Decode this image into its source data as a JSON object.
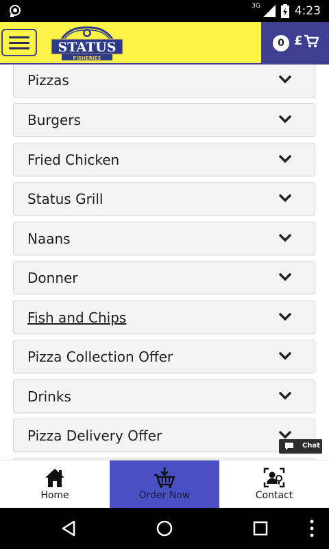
{
  "status_bar": {
    "time": "4:23",
    "network": "3G"
  },
  "header": {
    "logo_text": "STATUS",
    "logo_subtext": "FISHERIES",
    "cart_count": "0",
    "cart_currency": "£"
  },
  "categories": [
    {
      "label": "Pizzas"
    },
    {
      "label": "Burgers"
    },
    {
      "label": "Fried Chicken"
    },
    {
      "label": "Status Grill"
    },
    {
      "label": "Naans"
    },
    {
      "label": "Donner"
    },
    {
      "label": "Fish and Chips"
    },
    {
      "label": "Pizza Collection Offer"
    },
    {
      "label": "Drinks"
    },
    {
      "label": "Pizza Delivery Offer"
    }
  ],
  "chat": {
    "label": "Chat"
  },
  "bottom_nav": {
    "home": "Home",
    "order_now": "Order Now",
    "contact": "Contact"
  },
  "colors": {
    "header_bg": "#fcf348",
    "brand_blue": "#3e3f90",
    "active_nav": "#4950c4"
  }
}
